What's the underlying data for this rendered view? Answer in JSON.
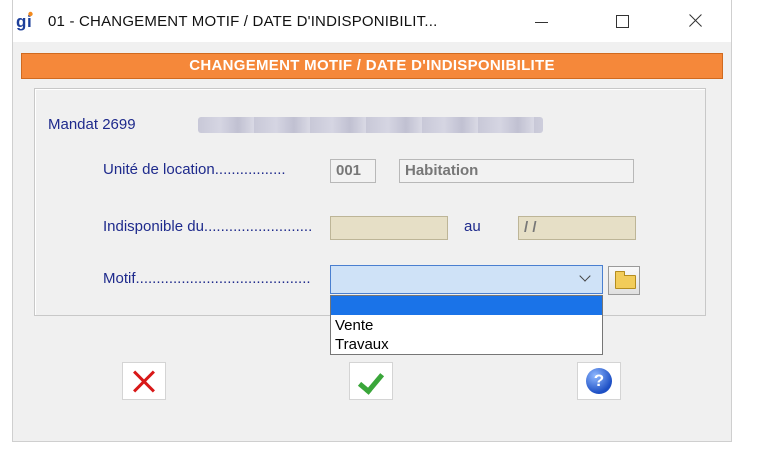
{
  "window": {
    "title": "01  -  CHANGEMENT MOTIF / DATE D'INDISPONIBILIT...",
    "app_icon": "gi-logo-icon"
  },
  "banner": {
    "text": "CHANGEMENT MOTIF / DATE D'INDISPONIBILITE",
    "color": "#f5883a"
  },
  "form": {
    "mandat_label": "Mandat 2699",
    "unite_label": "Unité de location.................",
    "unite_code": "001",
    "unite_type": "Habitation",
    "indispo_label": "Indisponible du..........................",
    "date_from": "",
    "au_label": "au",
    "date_to": " / /",
    "motif_label": "Motif..........................................",
    "motif_value": ""
  },
  "dropdown": {
    "options": [
      "",
      "Vente",
      "Travaux"
    ],
    "selected_index": 0
  },
  "actions": {
    "cancel_icon": "red-x-icon",
    "confirm_icon": "green-check-icon",
    "help_icon": "question-circle-icon",
    "help_glyph": "?"
  }
}
